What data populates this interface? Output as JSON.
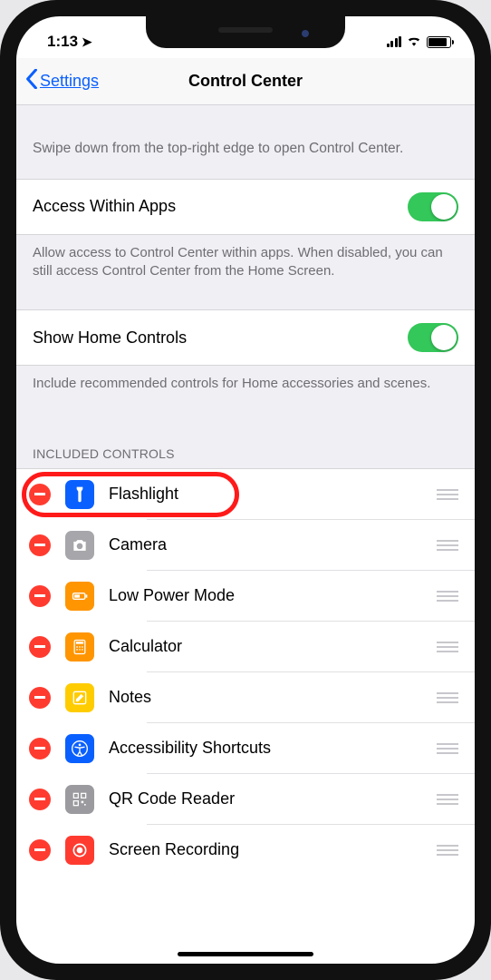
{
  "statusBar": {
    "time": "1:13"
  },
  "nav": {
    "backLabel": "Settings",
    "title": "Control Center"
  },
  "intro": "Swipe down from the top-right edge to open Control Center.",
  "toggles": {
    "accessWithinApps": {
      "label": "Access Within Apps",
      "on": true,
      "footer": "Allow access to Control Center within apps. When disabled, you can still access Control Center from the Home Screen."
    },
    "showHomeControls": {
      "label": "Show Home Controls",
      "on": true,
      "footer": "Include recommended controls for Home accessories and scenes."
    }
  },
  "includedHeader": "INCLUDED CONTROLS",
  "included": [
    {
      "name": "Flashlight",
      "iconBg": "#0a60ff",
      "icon": "flashlight"
    },
    {
      "name": "Camera",
      "iconBg": "#a6a6ab",
      "icon": "camera"
    },
    {
      "name": "Low Power Mode",
      "iconBg": "#ff9500",
      "icon": "battery"
    },
    {
      "name": "Calculator",
      "iconBg": "#ff9500",
      "icon": "calculator"
    },
    {
      "name": "Notes",
      "iconBg": "#ffcc00",
      "icon": "notes"
    },
    {
      "name": "Accessibility Shortcuts",
      "iconBg": "#0a60ff",
      "icon": "accessibility"
    },
    {
      "name": "QR Code Reader",
      "iconBg": "#9a9a9f",
      "icon": "qr"
    },
    {
      "name": "Screen Recording",
      "iconBg": "#ff3b30",
      "icon": "record"
    }
  ]
}
